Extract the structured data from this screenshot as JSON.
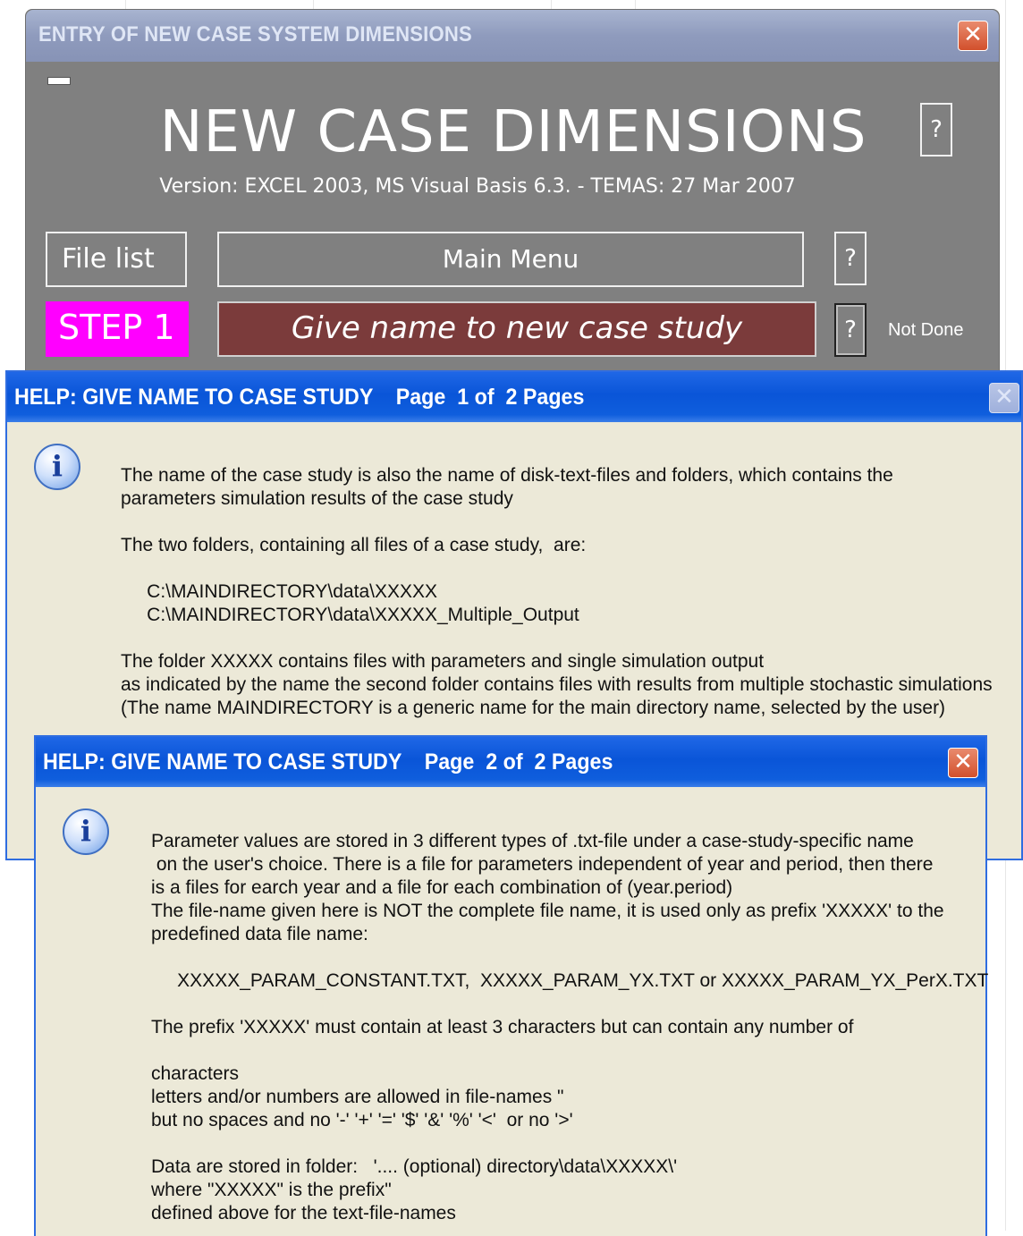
{
  "main_window": {
    "title": "ENTRY OF NEW CASE SYSTEM DIMENSIONS",
    "close_symbol": "✕",
    "heading": "NEW CASE DIMENSIONS",
    "help_symbol": "?",
    "version": "Version: EXCEL 2003, MS Visual Basis 6.3. - TEMAS: 27 Mar 2007",
    "file_list_label": "File list",
    "main_menu_label": "Main Menu",
    "step_label": "STEP 1",
    "give_name_label": "Give name to new case study",
    "status": "Not Done",
    "colors": {
      "step_bg": "#ff00ff",
      "give_name_bg": "#7b3b3b",
      "window_bg": "#808080"
    }
  },
  "help1": {
    "title": "HELP: GIVE NAME TO CASE STUDY    Page  1 of  2 Pages",
    "close_symbol": "✕",
    "icon": "info-icon",
    "lines": [
      "The name of the case study is also the name of disk-text-files and folders, which contains the",
      "parameters simulation results of the case study",
      "",
      "The two folders, containing all files of a case study,  are:",
      "",
      "     C:\\MAINDIRECTORY\\data\\XXXXX",
      "     C:\\MAINDIRECTORY\\data\\XXXXX_Multiple_Output",
      "",
      "The folder XXXXX contains files with parameters and single simulation output",
      "as indicated by the name the second folder contains files with results from multiple stochastic simulations",
      "(The name MAINDIRECTORY is a generic name for the main directory name, selected by the user)"
    ]
  },
  "help2": {
    "title": "HELP: GIVE NAME TO CASE STUDY    Page  2 of  2 Pages",
    "close_symbol": "✕",
    "icon": "info-icon",
    "lines": [
      "Parameter values are stored in 3 different types of .txt-file under a case-study-specific name",
      " on the user's choice. There is a file for parameters independent of year and period, then there",
      "is a files for earch year and a file for each combination of (year.period)",
      "The file-name given here is NOT the complete file name, it is used only as prefix 'XXXXX' to the",
      "predefined data file name:",
      "",
      "     XXXXX_PARAM_CONSTANT.TXT,  XXXXX_PARAM_YX.TXT or XXXXX_PARAM_YX_PerX.TXT",
      "",
      "The prefix 'XXXXX' must contain at least 3 characters but can contain any number of",
      "",
      "characters",
      "letters and/or numbers are allowed in file-names \"",
      "but no spaces and no '-' '+' '=' '$' '&' '%' '<'  or no '>'",
      "",
      "Data are stored in folder:   '.... (optional) directory\\data\\XXXXX\\'",
      "where \"XXXXX\" is the prefix\"",
      "defined above for the text-file-names"
    ]
  }
}
